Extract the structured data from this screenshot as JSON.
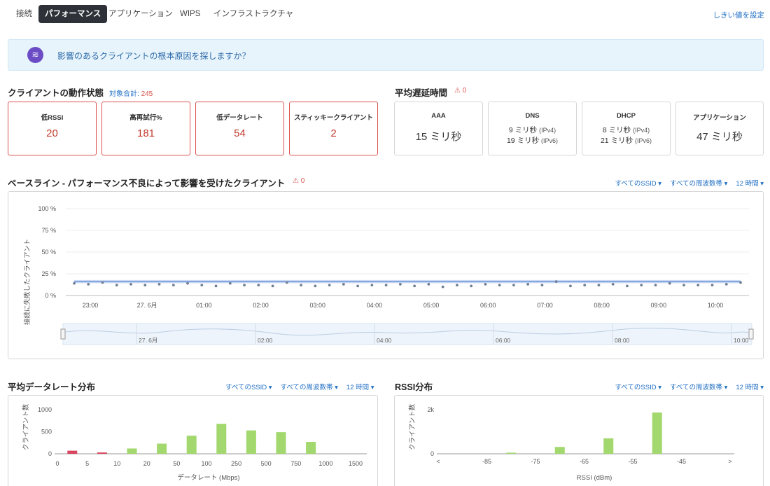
{
  "tabs": [
    {
      "label": "接続",
      "active": false
    },
    {
      "label": "パフォーマンス",
      "active": true
    },
    {
      "label": "アプリケーション",
      "active": false
    },
    {
      "label": "WIPS",
      "active": false
    },
    {
      "label": "インフラストラクチャ",
      "active": false
    }
  ],
  "threshold_link": "しきい値を設定",
  "banner": {
    "icon": "root-cause-icon",
    "text": "影響のあるクライアントの根本原因を探しますか？"
  },
  "client_status": {
    "title": "クライアントの動作状態",
    "total_label": "対象合計:",
    "total_value": "245",
    "cards": [
      {
        "label": "低RSSI",
        "value": "20"
      },
      {
        "label": "高再試行%",
        "value": "181"
      },
      {
        "label": "低データレート",
        "value": "54"
      },
      {
        "label": "スティッキークライアント",
        "value": "2"
      }
    ]
  },
  "latency": {
    "title": "平均遅延時間",
    "warn_icon": "warning-triangle-icon",
    "warn_count": "0",
    "cards": [
      {
        "label": "AAA",
        "value": "15 ミリ秒"
      },
      {
        "label": "DNS",
        "line1": "9 ミリ秒",
        "line1_unit": "(IPv4)",
        "line2": "19 ミリ秒",
        "line2_unit": "(IPv6)"
      },
      {
        "label": "DHCP",
        "line1": "8 ミリ秒",
        "line1_unit": "(IPv4)",
        "line2": "21 ミリ秒",
        "line2_unit": "(IPv6)"
      },
      {
        "label": "アプリケーション",
        "value": "47 ミリ秒"
      }
    ]
  },
  "baseline": {
    "title": "ベースライン - パフォーマンス不良によって影響を受けたクライアント",
    "warn_count": "0",
    "filters": [
      "すべてのSSID ▾",
      "すべての周波数帯 ▾",
      "12 時間 ▾"
    ],
    "ylabel": "接続に失敗したクライアント",
    "yticks": [
      "100 %",
      "75 %",
      "50 %",
      "25 %",
      "0 %"
    ],
    "xticks": [
      "23:00",
      "27. 6月",
      "01:00",
      "02:00",
      "03:00",
      "04:00",
      "05:00",
      "06:00",
      "07:00",
      "08:00",
      "09:00",
      "10:00"
    ],
    "navigator_ticks": [
      "27. 6月",
      "02:00",
      "04:00",
      "06:00",
      "08:00",
      "10:00"
    ]
  },
  "datarate": {
    "title": "平均データレート分布",
    "filters": [
      "すべてのSSID ▾",
      "すべての周波数帯 ▾",
      "12 時間 ▾"
    ],
    "ylabel": "クライアント数",
    "xlabel": "データレート (Mbps)",
    "yticks": [
      "1000",
      "500",
      "0"
    ]
  },
  "rssi": {
    "title": "RSSI分布",
    "filters": [
      "すべてのSSID ▾",
      "すべての周波数帯 ▾",
      "12 時間 ▾"
    ],
    "ylabel": "クライアント数",
    "xlabel": "RSSI (dBm)",
    "yticks": [
      "2k",
      "0"
    ]
  },
  "colors": {
    "accent": "#1f6fc4",
    "alert": "#d9534f",
    "good_bar": "#a3d86f",
    "bad_bar": "#d9455f",
    "baseline": "#6f96d8"
  },
  "chart_data": [
    {
      "type": "line",
      "ylabel": "接続に失敗したクライアント",
      "ylim": [
        0,
        100
      ],
      "x": [
        "22:45",
        "23:00",
        "23:15",
        "23:30",
        "23:45",
        "00:00",
        "00:15",
        "00:30",
        "00:45",
        "01:00",
        "01:15",
        "01:30",
        "01:45",
        "02:00",
        "02:15",
        "02:30",
        "02:45",
        "03:00",
        "03:15",
        "03:30",
        "03:45",
        "04:00",
        "04:15",
        "04:30",
        "04:45",
        "05:00",
        "05:15",
        "05:30",
        "05:45",
        "06:00",
        "06:15",
        "06:30",
        "06:45",
        "07:00",
        "07:15",
        "07:30",
        "07:45",
        "08:00",
        "08:15",
        "08:30",
        "08:45",
        "09:00",
        "09:15",
        "09:30",
        "09:45",
        "10:00",
        "10:15",
        "10:30"
      ],
      "values": [
        14,
        13,
        15,
        12,
        13,
        12,
        13,
        12,
        14,
        12,
        11,
        14,
        12,
        12,
        11,
        15,
        12,
        11,
        12,
        13,
        11,
        12,
        12,
        13,
        11,
        13,
        10,
        12,
        11,
        13,
        12,
        12,
        13,
        12,
        16,
        11,
        12,
        12,
        13,
        11,
        12,
        12,
        14,
        12,
        12,
        12,
        13,
        15
      ],
      "baseline_values": [
        16,
        16,
        16,
        16,
        16,
        16,
        16,
        16,
        16,
        16,
        16,
        16,
        16,
        16,
        16,
        16,
        16,
        16,
        16,
        16,
        16,
        16,
        16,
        16,
        16,
        16,
        16,
        16,
        16,
        16,
        16,
        16,
        16,
        16,
        16,
        16,
        16,
        16,
        16,
        16,
        16,
        16,
        16,
        16,
        16,
        16,
        16,
        16
      ],
      "grid": true
    },
    {
      "type": "bar",
      "xlabel": "データレート (Mbps)",
      "ylabel": "クライアント数",
      "categories": [
        "5",
        "10",
        "20",
        "50",
        "100",
        "250",
        "500",
        "750",
        "1000",
        "1500"
      ],
      "x_ticks": [
        "0",
        "5",
        "10",
        "20",
        "50",
        "100",
        "250",
        "500",
        "750",
        "1000",
        "1500"
      ],
      "values": [
        70,
        30,
        120,
        230,
        410,
        680,
        530,
        490,
        270,
        0
      ],
      "bar_colors": [
        "#d9455f",
        "#d9455f",
        "#a3d86f",
        "#a3d86f",
        "#a3d86f",
        "#a3d86f",
        "#a3d86f",
        "#a3d86f",
        "#a3d86f",
        "#a3d86f"
      ],
      "ylim": [
        0,
        1000
      ]
    },
    {
      "type": "bar",
      "xlabel": "RSSI (dBm)",
      "ylabel": "クライアント数",
      "categories": [
        "-75",
        "-65",
        "-55",
        "-45",
        ">"
      ],
      "x_ticks": [
        "<",
        "-85",
        "-75",
        "-65",
        "-55",
        "-45",
        ">"
      ],
      "values": [
        50,
        310,
        700,
        1870,
        0
      ],
      "ylim": [
        0,
        2000
      ]
    }
  ]
}
